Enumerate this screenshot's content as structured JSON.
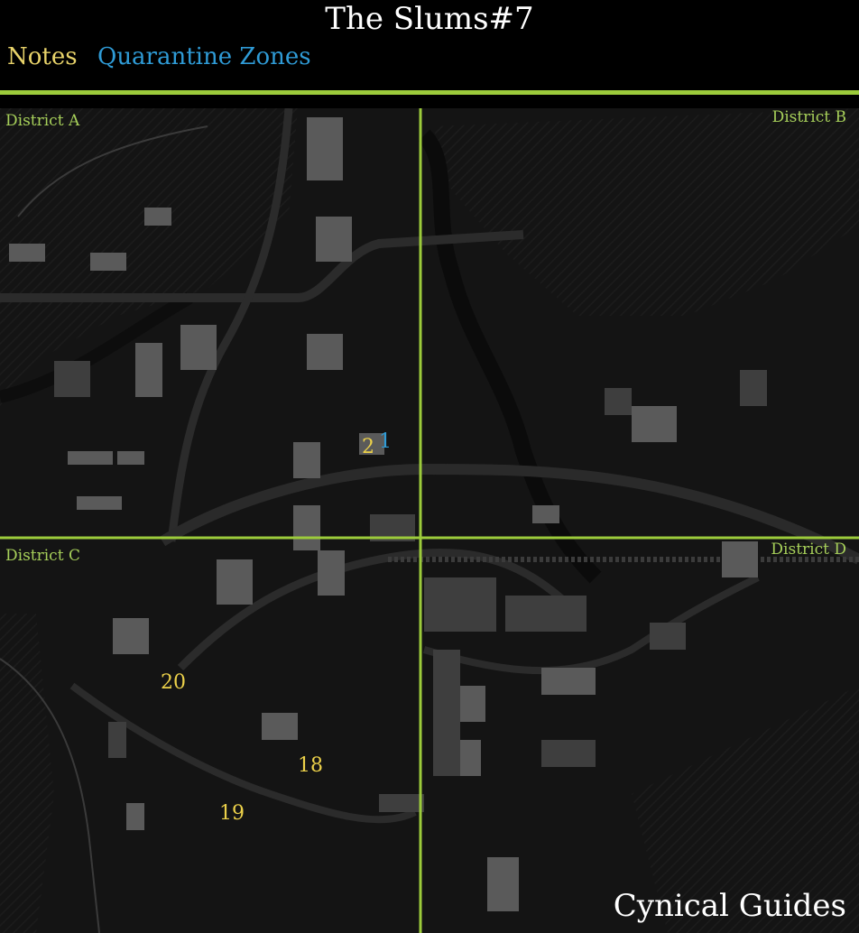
{
  "title": "The Slums#7",
  "legend": {
    "notes": "Notes",
    "quarantine_zones": "Quarantine Zones"
  },
  "colors": {
    "notes": "#ecd14a",
    "quarantine_zones": "#2f9bd6",
    "grid_lines": "#9ccb3b",
    "background": "#000000"
  },
  "districts": {
    "a": "District A",
    "b": "District B",
    "c": "District C",
    "d": "District D"
  },
  "markers": {
    "note_2": "2",
    "qz_1": "1",
    "note_20": "20",
    "note_18": "18",
    "note_19": "19"
  },
  "watermark": "Cynical Guides"
}
